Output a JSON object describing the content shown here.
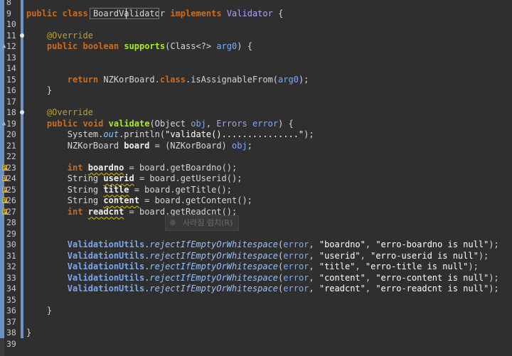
{
  "editor": {
    "lines": [
      {
        "n": "8"
      },
      {
        "n": "9"
      },
      {
        "n": "10"
      },
      {
        "n": "11"
      },
      {
        "n": "12"
      },
      {
        "n": "13"
      },
      {
        "n": "14"
      },
      {
        "n": "15"
      },
      {
        "n": "16"
      },
      {
        "n": "17"
      },
      {
        "n": "18"
      },
      {
        "n": "19"
      },
      {
        "n": "20"
      },
      {
        "n": "21"
      },
      {
        "n": "22"
      },
      {
        "n": "23"
      },
      {
        "n": "24"
      },
      {
        "n": "25"
      },
      {
        "n": "26"
      },
      {
        "n": "27"
      },
      {
        "n": "28"
      },
      {
        "n": "29"
      },
      {
        "n": "30"
      },
      {
        "n": "31"
      },
      {
        "n": "32"
      },
      {
        "n": "33"
      },
      {
        "n": "34"
      },
      {
        "n": "35"
      },
      {
        "n": "36"
      },
      {
        "n": "37"
      },
      {
        "n": "38"
      },
      {
        "n": "39"
      }
    ],
    "code": {
      "l9_public": "public",
      "l9_class": "class",
      "l9_name": "BoardValidator",
      "l9_implements": "implements",
      "l9_iface": "Validator",
      "l9_brace": "{",
      "l11_ann": "@Override",
      "l12_public": "public",
      "l12_boolean": "boolean",
      "l12_fn": "supports",
      "l12_sig": "(Class<?> ",
      "l12_param": "arg0",
      "l12_end": ") {",
      "l15_return": "return",
      "l15_cls": " NZKorBoard.",
      "l15_class": "class",
      "l15_call": ".isAssignableFrom(",
      "l15_param": "arg0",
      "l15_end": ");",
      "l16_brace": "}",
      "l18_ann": "@Override",
      "l19_public": "public",
      "l19_void": "void",
      "l19_fn": "validate",
      "l19_sig1": "(Object ",
      "l19_p1": "obj",
      "l19_sig2": ", ",
      "l19_errtype": "Errors",
      "l19_sig3": " ",
      "l19_p2": "error",
      "l19_end": ") {",
      "l20_a": "System.",
      "l20_out": "out",
      "l20_b": ".println(",
      "l20_str": "\"validate()...............\"",
      "l20_end": ");",
      "l21_a": "NZKorBoard ",
      "l21_var": "board",
      "l21_b": " = (NZKorBoard) ",
      "l21_p": "obj",
      "l21_end": ";",
      "l23_type": "int",
      "l23_var": "boardno",
      "l23_rest": " = board.getBoardno();",
      "l24_type": "String ",
      "l24_var": "userid",
      "l24_rest": " = board.getUserid();",
      "l25_type": "String ",
      "l25_var": "title",
      "l25_rest": " = board.getTitle();",
      "l26_type": "String ",
      "l26_var": "content",
      "l26_rest": " = board.getContent();",
      "l27_type": "int",
      "l27_var": "readcnt",
      "l27_rest": " = board.getReadcnt();",
      "vu": "ValidationUtils",
      "dot": ".",
      "method": "rejectIfEmptyOrWhitespace",
      "open": "(",
      "err": "error",
      "comma": ", ",
      "close": ");",
      "l30_s1": "\"boardno\"",
      "l30_s2": "\"erro-boardno is null\"",
      "l31_s1": "\"userid\"",
      "l31_s2": "\"erro-userid is null\"",
      "l32_s1": "\"title\"",
      "l32_s2": "\"erro-title is null\"",
      "l33_s1": "\"content\"",
      "l33_s2": "\"erro-content is null\"",
      "l34_s1": "\"readcnt\"",
      "l34_s2": "\"erro-readcnt is null\"",
      "l36_brace": "}",
      "l38_brace": "}"
    },
    "tooltip": "사라짐 럼치(R)"
  },
  "colors": {
    "background": "#2f2f2f",
    "keyword": "#cc6c1d",
    "method": "#a7ec21",
    "param": "#79abff",
    "change_bar": "#6d93c4"
  }
}
